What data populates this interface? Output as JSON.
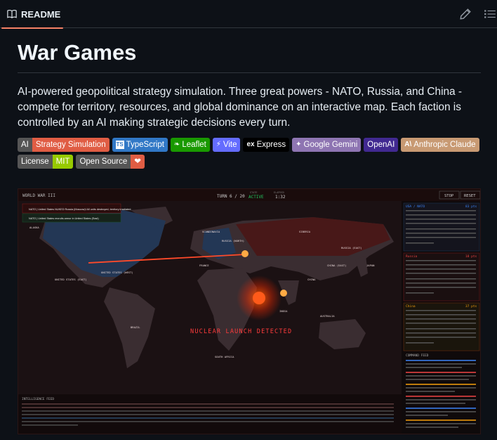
{
  "header": {
    "tab_label": "README",
    "edit_icon": "pencil-icon",
    "outline_icon": "list-icon"
  },
  "readme": {
    "title": "War Games",
    "description": "AI-powered geopolitical strategy simulation. Three great powers - NATO, Russia, and China - compete for territory, resources, and global dominance on an interactive map. Each faction is controlled by an AI making strategic decisions every turn.",
    "badges": [
      {
        "left": "AI",
        "right": "Strategy Simulation",
        "color": "#e05d44"
      },
      {
        "left": "",
        "right": "TypeScript",
        "color": "#3178c6"
      },
      {
        "left": "",
        "right": "Leaflet",
        "color": "#199900"
      },
      {
        "left": "",
        "right": "Vite",
        "color": "#646cff"
      },
      {
        "left": "",
        "right": "Express",
        "color": "#000000"
      },
      {
        "left": "",
        "right": "Google Gemini",
        "color": "#8e75b2"
      },
      {
        "left": "",
        "right": "OpenAI",
        "color": "#412991"
      },
      {
        "left": "",
        "right": "Anthropic Claude",
        "color": "#d4a27f"
      },
      {
        "left": "License",
        "right": "MIT",
        "color": "#97ca00"
      },
      {
        "left": "Open Source",
        "right": "❤",
        "color": "#e05d44"
      }
    ]
  },
  "game": {
    "title": "WORLD WAR III",
    "turn": "TURN 6 / 20",
    "state_label": "STATE",
    "state": "ACTIVE",
    "elapsed_label": "ELAPSED",
    "elapsed": "1:32",
    "stop": "STOP",
    "reset": "RESET",
    "alert": "NUCLEAR LAUNCH DETECTED",
    "notifications": [
      "NATO | United States NUKED Russia (Moscow)! All units destroyed, territory irradiated.",
      "NATO | United States recruits armor in United States (East)"
    ],
    "cities": [
      "ALASKA",
      "SCANDINAVIA",
      "RUSSIA (NORTH)",
      "SIBERIA",
      "RUSSIA (EAST)",
      "UNITED STATES (EAST)",
      "UNITED STATES (WEST)",
      "FRANCE",
      "CHINA",
      "CHINA (EAST)",
      "BRAZIL",
      "AUSTRALIA",
      "SOUTH AFRICA",
      "INDIA",
      "JAPAN"
    ],
    "factions": [
      {
        "name": "USA / NATO",
        "score": "83 pts",
        "color": "#3b82f6"
      },
      {
        "name": "Russia",
        "score": "18 pts",
        "color": "#ef4444"
      },
      {
        "name": "China",
        "score": "37 pts",
        "color": "#f59e0b"
      }
    ],
    "command_feed_label": "COMMAND FEED",
    "intelligence_feed_label": "INTELLIGENCE FEED"
  }
}
